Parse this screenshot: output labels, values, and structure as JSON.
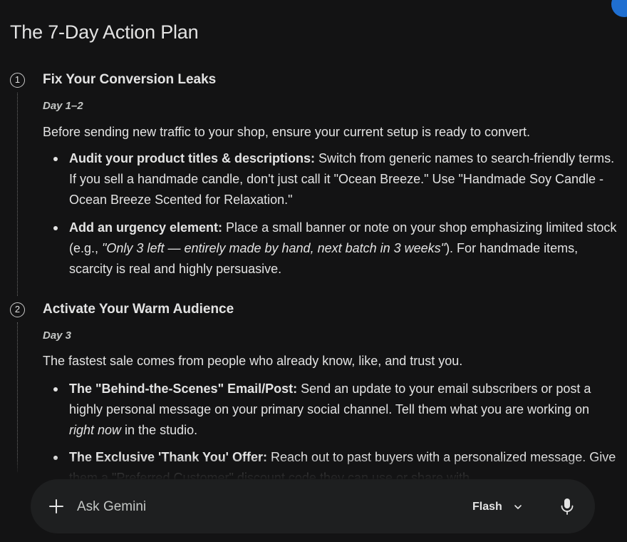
{
  "page": {
    "title": "The 7-Day Action Plan"
  },
  "steps": [
    {
      "number": "1",
      "title": "Fix Your Conversion Leaks",
      "day": "Day 1–2",
      "intro": "Before sending new traffic to your shop, ensure your current setup is ready to convert.",
      "bullets": [
        {
          "bold": "Audit your product titles & descriptions:",
          "text": " Switch from generic names to search-friendly terms. If you sell a handmade candle, don't just call it \"Ocean Breeze.\" Use \"Handmade Soy Candle - Ocean Breeze Scented for Relaxation.\""
        },
        {
          "bold": "Add an urgency element:",
          "text_before": " Place a small banner or note on your shop emphasizing limited stock (e.g., ",
          "italic": "\"Only 3 left — entirely made by hand, next batch in 3 weeks\"",
          "text_after": "). For handmade items, scarcity is real and highly persuasive."
        }
      ]
    },
    {
      "number": "2",
      "title": "Activate Your Warm Audience",
      "day": "Day 3",
      "intro": "The fastest sale comes from people who already know, like, and trust you.",
      "bullets": [
        {
          "bold": "The \"Behind-the-Scenes\" Email/Post:",
          "text_before": " Send an update to your email subscribers or post a highly personal message on your primary social channel. Tell them what you are working on ",
          "italic": "right now",
          "text_after": " in the studio."
        },
        {
          "bold": "The Exclusive 'Thank You' Offer:",
          "text": " Reach out to past buyers with a personalized message. Give them a \"Preferred Customer\" discount code they can use or share with"
        }
      ]
    }
  ],
  "composer": {
    "placeholder": "Ask Gemini",
    "model": "Flash",
    "icons": {
      "add": "plus-icon",
      "model_dropdown": "chevron-down-icon",
      "voice": "microphone-icon"
    }
  },
  "colors": {
    "background": "#131314",
    "text": "#e3e3e3",
    "composer_background": "#1e1f20",
    "accent": "#1f6fd1"
  }
}
